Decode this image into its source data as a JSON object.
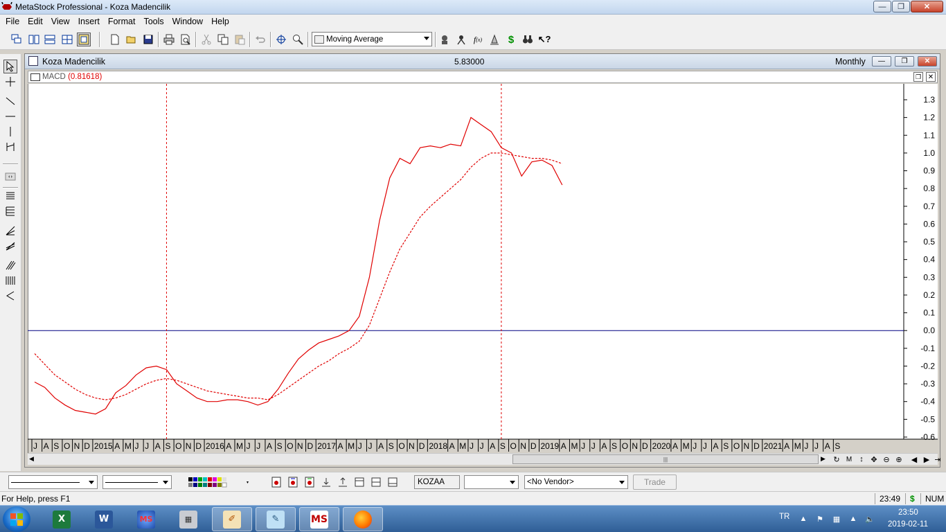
{
  "window": {
    "title": "MetaStock Professional - Koza Madencilik"
  },
  "menu": [
    "File",
    "Edit",
    "View",
    "Insert",
    "Format",
    "Tools",
    "Window",
    "Help"
  ],
  "toolbar": {
    "indicator_select": "Moving Average"
  },
  "chart_window": {
    "title": "Koza Madencilik",
    "price": "5.83000",
    "period": "Monthly",
    "indicator_name": "MACD",
    "indicator_value": "(0.81618)"
  },
  "bottom_toolbar": {
    "symbol": "KOZAA",
    "vendor": "<No Vendor>",
    "trade_label": "Trade"
  },
  "status_bar": {
    "help": "For Help, press F1",
    "time": "23:49",
    "dollar": "$",
    "num": "NUM"
  },
  "taskbar": {
    "lang": "TR",
    "clock_time": "23:50",
    "clock_date": "2019-02-11",
    "apps": [
      "Excel",
      "Word",
      "MetaStock Downloader",
      "Calculator",
      "Paint",
      "Notepad",
      "MetaStock",
      "Firefox"
    ]
  },
  "colors": {
    "macd_line": "#e00000",
    "signal_line": "#e00000",
    "zero_line": "#000080",
    "vertical_marker": "#e00000"
  },
  "chart_data": {
    "type": "line",
    "title": "MACD (0.81618)",
    "ylim": [
      -0.65,
      1.35
    ],
    "y_ticks": [
      "1.3",
      "1.2",
      "1.1",
      "1.0",
      "0.9",
      "0.8",
      "0.7",
      "0.6",
      "0.5",
      "0.4",
      "0.3",
      "0.2",
      "0.1",
      "0.0",
      "-0.1",
      "-0.2",
      "-0.3",
      "-0.4",
      "-0.5",
      "-0.6"
    ],
    "x_axis_labels": [
      "J",
      "A",
      "S",
      "O",
      "N",
      "D",
      "2015",
      "A",
      "M",
      "J",
      "J",
      "A",
      "S",
      "O",
      "N",
      "D",
      "2016",
      "A",
      "M",
      "J",
      "J",
      "A",
      "S",
      "O",
      "N",
      "D",
      "2017",
      "A",
      "M",
      "J",
      "J",
      "A",
      "S",
      "O",
      "N",
      "D",
      "2018",
      "A",
      "M",
      "J",
      "J",
      "A",
      "S",
      "O",
      "N",
      "D",
      "2019",
      "A",
      "M",
      "J",
      "J",
      "A",
      "S",
      "O",
      "N",
      "D",
      "2020",
      "A",
      "M",
      "J",
      "J",
      "A",
      "S",
      "O",
      "N",
      "D",
      "2021",
      "A",
      "M",
      "J",
      "J",
      "A",
      "S"
    ],
    "x_label_months": [
      0,
      1,
      2,
      3,
      4,
      5,
      6,
      8,
      9,
      10,
      11,
      12,
      13,
      14,
      15,
      16,
      17,
      19,
      20,
      21,
      22,
      23,
      24,
      25,
      26,
      27,
      28,
      30,
      31,
      32,
      33,
      34,
      35,
      36,
      37,
      38,
      39,
      41,
      42,
      43,
      44,
      45,
      46,
      47,
      48,
      49,
      50,
      52,
      53,
      54,
      55,
      56,
      57,
      58,
      59,
      60,
      61,
      63,
      64,
      65,
      66,
      67,
      68,
      69,
      70,
      71,
      72,
      74,
      75,
      76,
      77,
      78,
      79
    ],
    "series": [
      {
        "name": "MACD",
        "style": "solid",
        "values": [
          -0.29,
          -0.32,
          -0.38,
          -0.42,
          -0.45,
          -0.46,
          -0.47,
          -0.44,
          -0.35,
          -0.31,
          -0.25,
          -0.21,
          -0.2,
          -0.22,
          -0.3,
          -0.34,
          -0.38,
          -0.4,
          -0.4,
          -0.39,
          -0.39,
          -0.4,
          -0.42,
          -0.4,
          -0.33,
          -0.24,
          -0.16,
          -0.11,
          -0.07,
          -0.05,
          -0.03,
          0.0,
          0.08,
          0.3,
          0.62,
          0.86,
          0.97,
          0.94,
          1.03,
          1.04,
          1.03,
          1.05,
          1.04,
          1.2,
          1.16,
          1.12,
          1.03,
          1.0,
          0.87,
          0.95,
          0.96,
          0.93,
          0.82
        ]
      },
      {
        "name": "Signal",
        "style": "dashed",
        "values": [
          -0.13,
          -0.19,
          -0.25,
          -0.29,
          -0.33,
          -0.36,
          -0.38,
          -0.39,
          -0.38,
          -0.36,
          -0.33,
          -0.3,
          -0.28,
          -0.27,
          -0.28,
          -0.3,
          -0.32,
          -0.34,
          -0.35,
          -0.36,
          -0.37,
          -0.38,
          -0.38,
          -0.39,
          -0.36,
          -0.32,
          -0.28,
          -0.24,
          -0.2,
          -0.17,
          -0.13,
          -0.1,
          -0.06,
          0.03,
          0.18,
          0.33,
          0.46,
          0.55,
          0.64,
          0.7,
          0.75,
          0.8,
          0.85,
          0.92,
          0.97,
          1.0,
          1.0,
          0.99,
          0.98,
          0.97,
          0.97,
          0.96,
          0.94
        ]
      }
    ],
    "x_start": "2014-06",
    "zero_line": 0.0,
    "vertical_markers": [
      "2015-07",
      "2018-04"
    ],
    "grid": false
  }
}
